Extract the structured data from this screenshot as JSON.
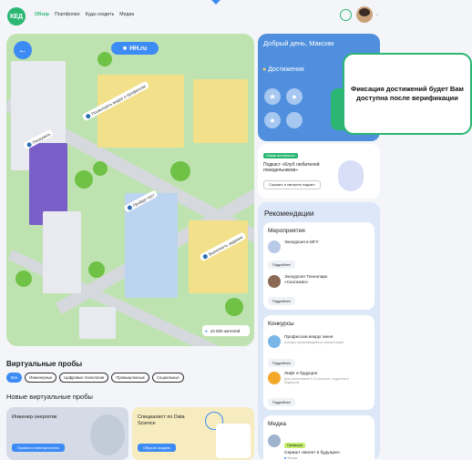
{
  "nav": {
    "logo": "КЕД",
    "links": [
      "Обзор",
      "Портфолио",
      "Куда сходить",
      "Медиа"
    ]
  },
  "hero": {
    "brand": "HH.ru",
    "flags": [
      "Посмотреть видео о профессии",
      "Погрузись",
      "Пройди тест",
      "Выполнить задание"
    ],
    "viewers": "10 000 жителей"
  },
  "virtual": {
    "title": "Виртуальные пробы",
    "chips": [
      "Все",
      "Инженерные",
      "Цифровые технологии",
      "Промышленные",
      "Социальные"
    ],
    "new_title": "Новые виртуальные пробы",
    "cards": [
      {
        "title": "Инженер-энергетик",
        "button": "Провести электричество"
      },
      {
        "title": "Специалист по Data Science",
        "button": "Обучить модель"
      }
    ]
  },
  "greeting": {
    "text": "Добрый день, Максим",
    "achievements": "Достижения"
  },
  "tooltip": "Фиксация достижений будет Вам доступна после верификации",
  "podcast": {
    "badge": "Новая активность",
    "title": "Подкаст «Клуб любителей понедельников»",
    "button": "Слушать и смотреть подкаст"
  },
  "recommendations": {
    "title": "Рекомендации",
    "events": {
      "title": "Мероприятия",
      "items": [
        {
          "text": "Экскурсия в МГУ",
          "more": "Подробнее"
        },
        {
          "text": "Экскурсия Технопарк «Сколково»",
          "more": "Подробнее"
        }
      ]
    },
    "contests": {
      "title": "Конкурсы",
      "items": [
        {
          "text": "Профессии вокруг меня",
          "sub": "Конкурс мультимедийных презентаций",
          "more": "Подробнее"
        },
        {
          "text": "Лифт в будущее",
          "sub": "Для школьников 9-11 классов, студентов и педагогов",
          "more": "Подробнее"
        }
      ]
    },
    "media": {
      "title": "Медиа",
      "badge": "Премьера",
      "item": "Сериал «Билет в будущее»",
      "type": "Фильм"
    }
  },
  "colors": {
    "accent": "#3d8bf5",
    "brand": "#2bb673"
  }
}
